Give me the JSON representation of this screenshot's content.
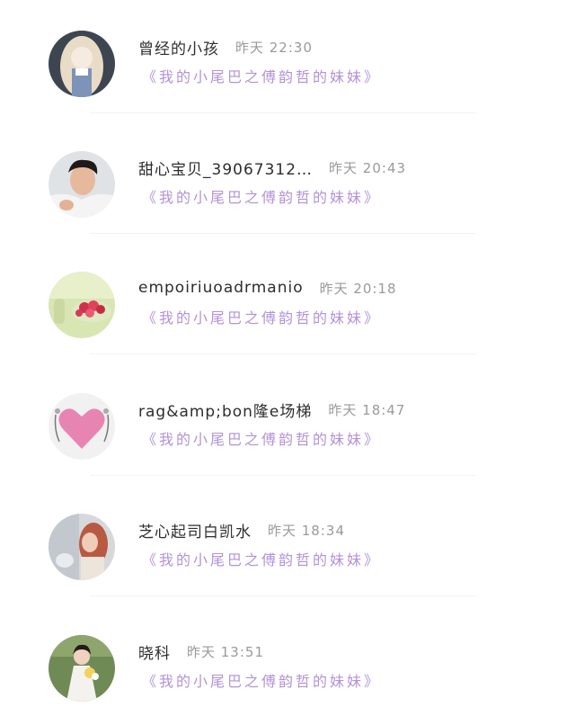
{
  "comments": [
    {
      "username": "曾经的小孩",
      "time": "昨天 22:30",
      "title": "《我的小尾巴之傅韵哲的妹妹》",
      "avatar_icon": "girl-anime-avatar"
    },
    {
      "username": "甜心宝贝_39067312…",
      "time": "昨天 20:43",
      "title": "《我的小尾巴之傅韵哲的妹妹》",
      "avatar_icon": "boy-photo-avatar"
    },
    {
      "username": "empoiriuoadrmanio",
      "time": "昨天 20:18",
      "title": "《我的小尾巴之傅韵哲的妹妹》",
      "avatar_icon": "flower-photo-avatar"
    },
    {
      "username": "rag&amp;bon隆e场梯",
      "time": "昨天 18:47",
      "title": "《我的小尾巴之傅韵哲的妹妹》",
      "avatar_icon": "heart-avatar"
    },
    {
      "username": "芝心起司白凯水",
      "time": "昨天 18:34",
      "title": "《我的小尾巴之傅韵哲的妹妹》",
      "avatar_icon": "girl-photo-avatar"
    },
    {
      "username": "晓科",
      "time": "昨天 13:51",
      "title": "《我的小尾巴之傅韵哲的妹妹》",
      "avatar_icon": "woman-bouquet-avatar"
    }
  ]
}
